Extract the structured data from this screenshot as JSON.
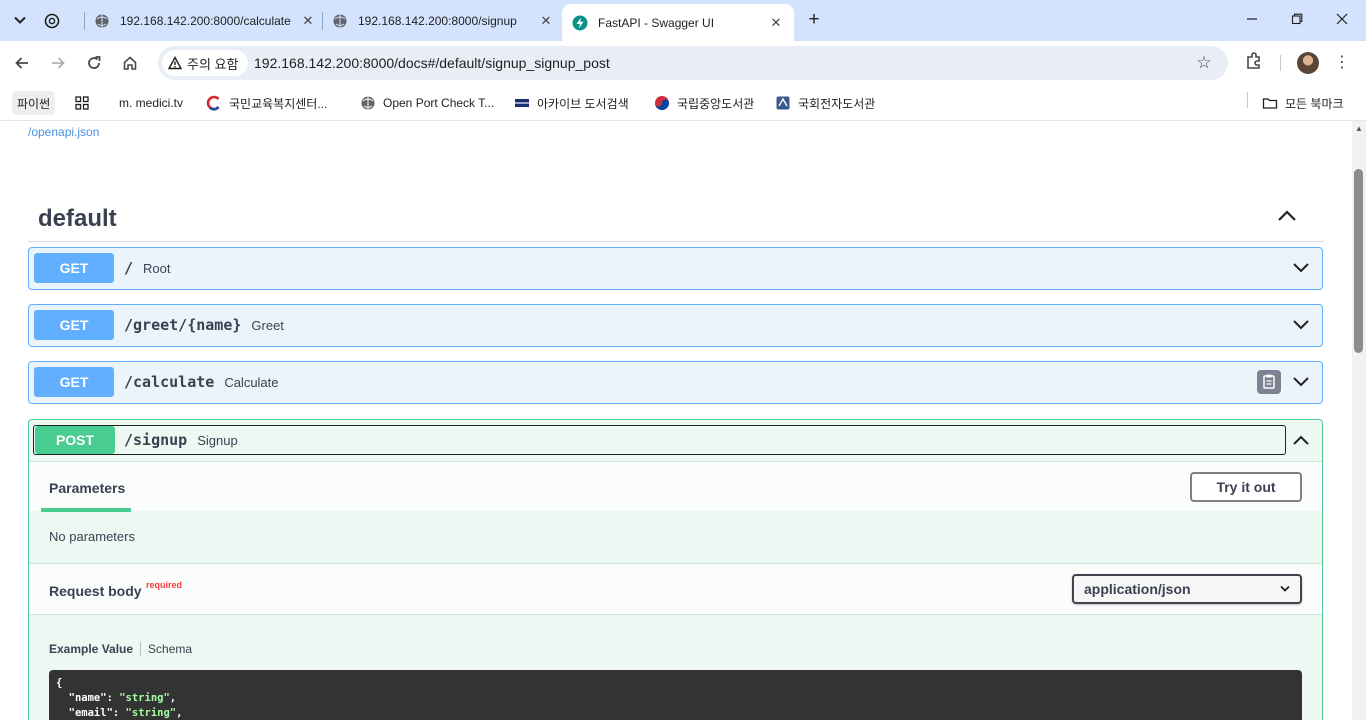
{
  "browser": {
    "tabs": [
      {
        "title": "192.168.142.200:8000/calculate"
      },
      {
        "title": "192.168.142.200:8000/signup"
      },
      {
        "title": "FastAPI - Swagger UI"
      }
    ],
    "security_chip": "주의 요함",
    "url": "192.168.142.200:8000/docs#/default/signup_signup_post",
    "bookmarks": [
      {
        "label": "파이썬"
      },
      {
        "label": "m. medici.tv"
      },
      {
        "label": "국민교육복지센터..."
      },
      {
        "label": "Open Port Check T..."
      },
      {
        "label": "아카이브 도서검색"
      },
      {
        "label": "국립중앙도서관"
      },
      {
        "label": "국회전자도서관"
      }
    ],
    "all_bookmarks": "모든 북마크"
  },
  "page": {
    "openapi_link": "/openapi.json",
    "section_title": "default",
    "operations": [
      {
        "method": "GET",
        "path": "/",
        "summary": "Root"
      },
      {
        "method": "GET",
        "path": "/greet/{name}",
        "summary": "Greet"
      },
      {
        "method": "GET",
        "path": "/calculate",
        "summary": "Calculate"
      },
      {
        "method": "POST",
        "path": "/signup",
        "summary": "Signup"
      }
    ],
    "signup": {
      "params_tab": "Parameters",
      "try_button": "Try it out",
      "no_params": "No parameters",
      "request_body": "Request body",
      "required_flag": "required",
      "content_type": "application/json",
      "example_tab": "Example Value",
      "schema_tab": "Schema",
      "code": {
        "open": "{",
        "line1_key": "  \"name\": ",
        "line1_val": "\"string\"",
        "line1_end": ",",
        "line2_key": "  \"email\": ",
        "line2_val": "\"string\"",
        "line2_end": ","
      }
    }
  },
  "colors": {
    "get": "#61affe",
    "post": "#49cc90",
    "required": "#f93e3e",
    "tabstrip": "#d3e3fd"
  }
}
